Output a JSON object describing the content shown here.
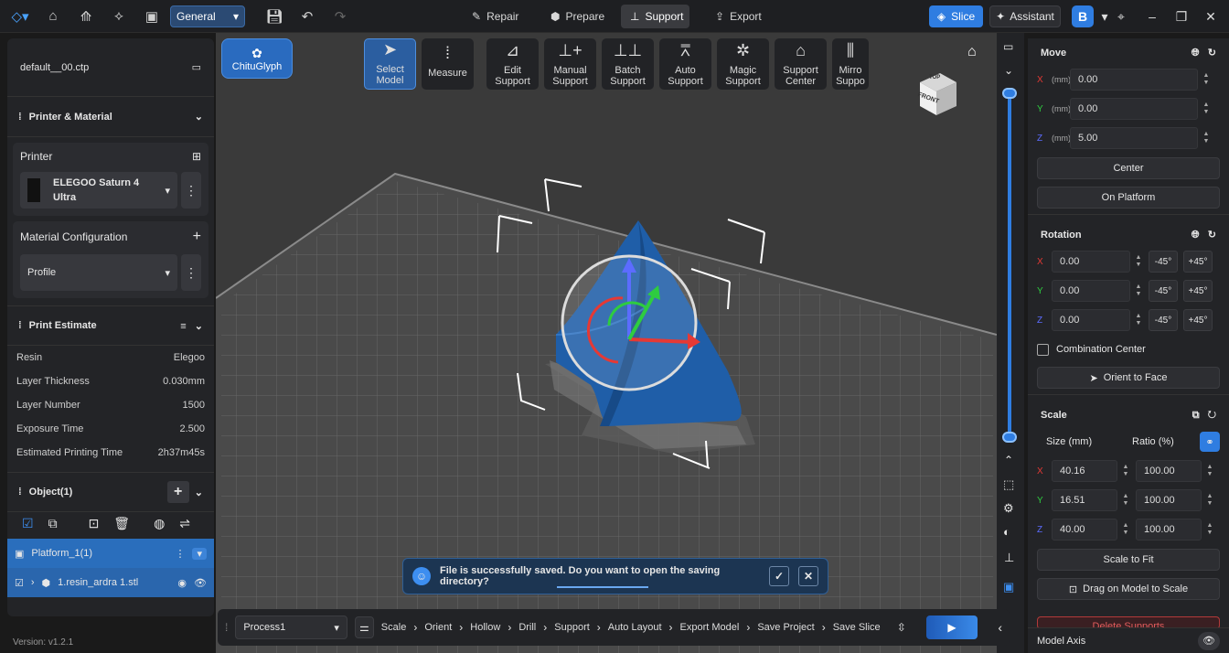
{
  "topbar": {
    "workspace": "General",
    "tabs": [
      {
        "label": "Repair",
        "icon": "repair-icon"
      },
      {
        "label": "Prepare",
        "icon": "cube-icon"
      },
      {
        "label": "Support",
        "icon": "support-icon"
      },
      {
        "label": "Export",
        "icon": "export-icon"
      }
    ],
    "active_tab": "Support",
    "slice_label": "Slice",
    "assistant_label": "Assistant"
  },
  "colors": {
    "accent": "#2f7de1",
    "panel": "#232427",
    "viewport": "#3a3a3a",
    "model": "#1f5ea8"
  },
  "left_panel": {
    "file_name": "default__00.ctp",
    "printer_section": {
      "title": "Printer & Material",
      "printer_label": "Printer",
      "printer_name_line1": "ELEGOO Saturn 4",
      "printer_name_line2": "Ultra",
      "material_label": "Material Configuration",
      "profile_label": "Profile"
    },
    "estimate": {
      "title": "Print Estimate",
      "rows": [
        {
          "label": "Resin",
          "value": "Elegoo"
        },
        {
          "label": "Layer Thickness",
          "value": "0.030mm"
        },
        {
          "label": "Layer Number",
          "value": "1500"
        },
        {
          "label": "Exposure Time",
          "value": "2.500"
        },
        {
          "label": "Estimated Printing Time",
          "value": "2h37m45s"
        }
      ]
    },
    "objects": {
      "title": "Object(1)",
      "platform": "Platform_1(1)",
      "model_file": "1.resin_ardra 1.stl"
    }
  },
  "toolbar": {
    "chitu": "ChituGlyph",
    "tools": [
      {
        "line1": "Select",
        "line2": "Model",
        "icon": "cursor-icon"
      },
      {
        "line1": "Measure",
        "line2": "",
        "icon": "ruler-icon"
      },
      {
        "line1": "Edit",
        "line2": "Support",
        "icon": "edit-support-icon"
      },
      {
        "line1": "Manual",
        "line2": "Support",
        "icon": "manual-support-icon"
      },
      {
        "line1": "Batch",
        "line2": "Support",
        "icon": "batch-support-icon"
      },
      {
        "line1": "Auto",
        "line2": "Support",
        "icon": "auto-support-icon"
      },
      {
        "line1": "Magic",
        "line2": "Support",
        "icon": "magic-support-icon"
      },
      {
        "line1": "Support",
        "line2": "Center",
        "icon": "support-center-icon"
      },
      {
        "line1": "Mirro",
        "line2": "Suppo",
        "icon": "mirror-support-icon"
      }
    ]
  },
  "viewcube": {
    "top": "TOP",
    "front": "FRONT"
  },
  "right_panel": {
    "move": {
      "title": "Move",
      "unit": "(mm)",
      "x": "0.00",
      "y": "0.00",
      "z": "5.00",
      "center_label": "Center",
      "platform_label": "On Platform"
    },
    "rotation": {
      "title": "Rotation",
      "x": "0.00",
      "y": "0.00",
      "z": "0.00",
      "minus": "-45°",
      "plus": "+45°",
      "combination_label": "Combination Center",
      "orient_label": "Orient to Face"
    },
    "scale": {
      "title": "Scale",
      "size_header": "Size (mm)",
      "ratio_header": "Ratio (%)",
      "x": "40.16",
      "y": "16.51",
      "z": "40.00",
      "rx": "100.00",
      "ry": "100.00",
      "rz": "100.00",
      "fit_label": "Scale to Fit",
      "drag_label": "Drag on Model to Scale",
      "delete_label": "Delete Supports"
    },
    "model_axis_label": "Model Axis"
  },
  "bottom": {
    "process": "Process1",
    "steps": [
      "Scale",
      "Orient",
      "Hollow",
      "Drill",
      "Support",
      "Auto Layout",
      "Export Model",
      "Save Project",
      "Save Slice"
    ]
  },
  "toast": {
    "message": "File is successfully saved. Do you want to open the saving directory?"
  },
  "version": "Version: v1.2.1"
}
